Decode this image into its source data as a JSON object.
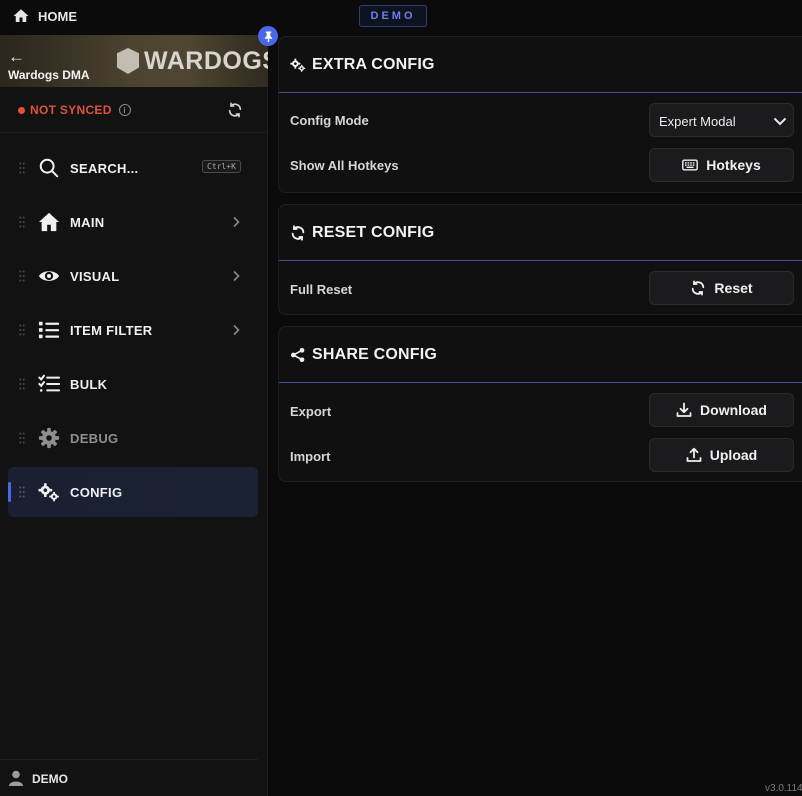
{
  "topbar": {
    "home_label": "HOME",
    "demo_badge": "DEMO"
  },
  "sidebar": {
    "banner": {
      "app_name": "Wardogs DMA",
      "logo_text": "WARDOGS"
    },
    "sync": {
      "status": "NOT SYNCED",
      "status_color": "#e0523c"
    },
    "items": [
      {
        "label": "SEARCH...",
        "icon": "search-icon",
        "shortcut": "Ctrl+K"
      },
      {
        "label": "MAIN",
        "icon": "home-icon"
      },
      {
        "label": "VISUAL",
        "icon": "eye-icon"
      },
      {
        "label": "ITEM FILTER",
        "icon": "list-icon"
      },
      {
        "label": "BULK",
        "icon": "checklist-icon"
      },
      {
        "label": "DEBUG",
        "icon": "gear-icon"
      },
      {
        "label": "CONFIG",
        "icon": "gears-icon",
        "active": true
      }
    ],
    "user": {
      "name": "DEMO"
    }
  },
  "main": {
    "extra_config": {
      "title": "EXTRA CONFIG",
      "config_mode_label": "Config Mode",
      "config_mode_value": "Expert Modal",
      "hotkeys_label": "Show All Hotkeys",
      "hotkeys_button": "Hotkeys"
    },
    "reset_config": {
      "title": "RESET CONFIG",
      "full_reset_label": "Full Reset",
      "reset_button": "Reset"
    },
    "share_config": {
      "title": "SHARE CONFIG",
      "export_label": "Export",
      "download_button": "Download",
      "import_label": "Import",
      "upload_button": "Upload"
    }
  },
  "version": "v3.0.114",
  "colors": {
    "accent": "#4a67e8",
    "background": "#0b0b0c",
    "card": "#101011"
  }
}
